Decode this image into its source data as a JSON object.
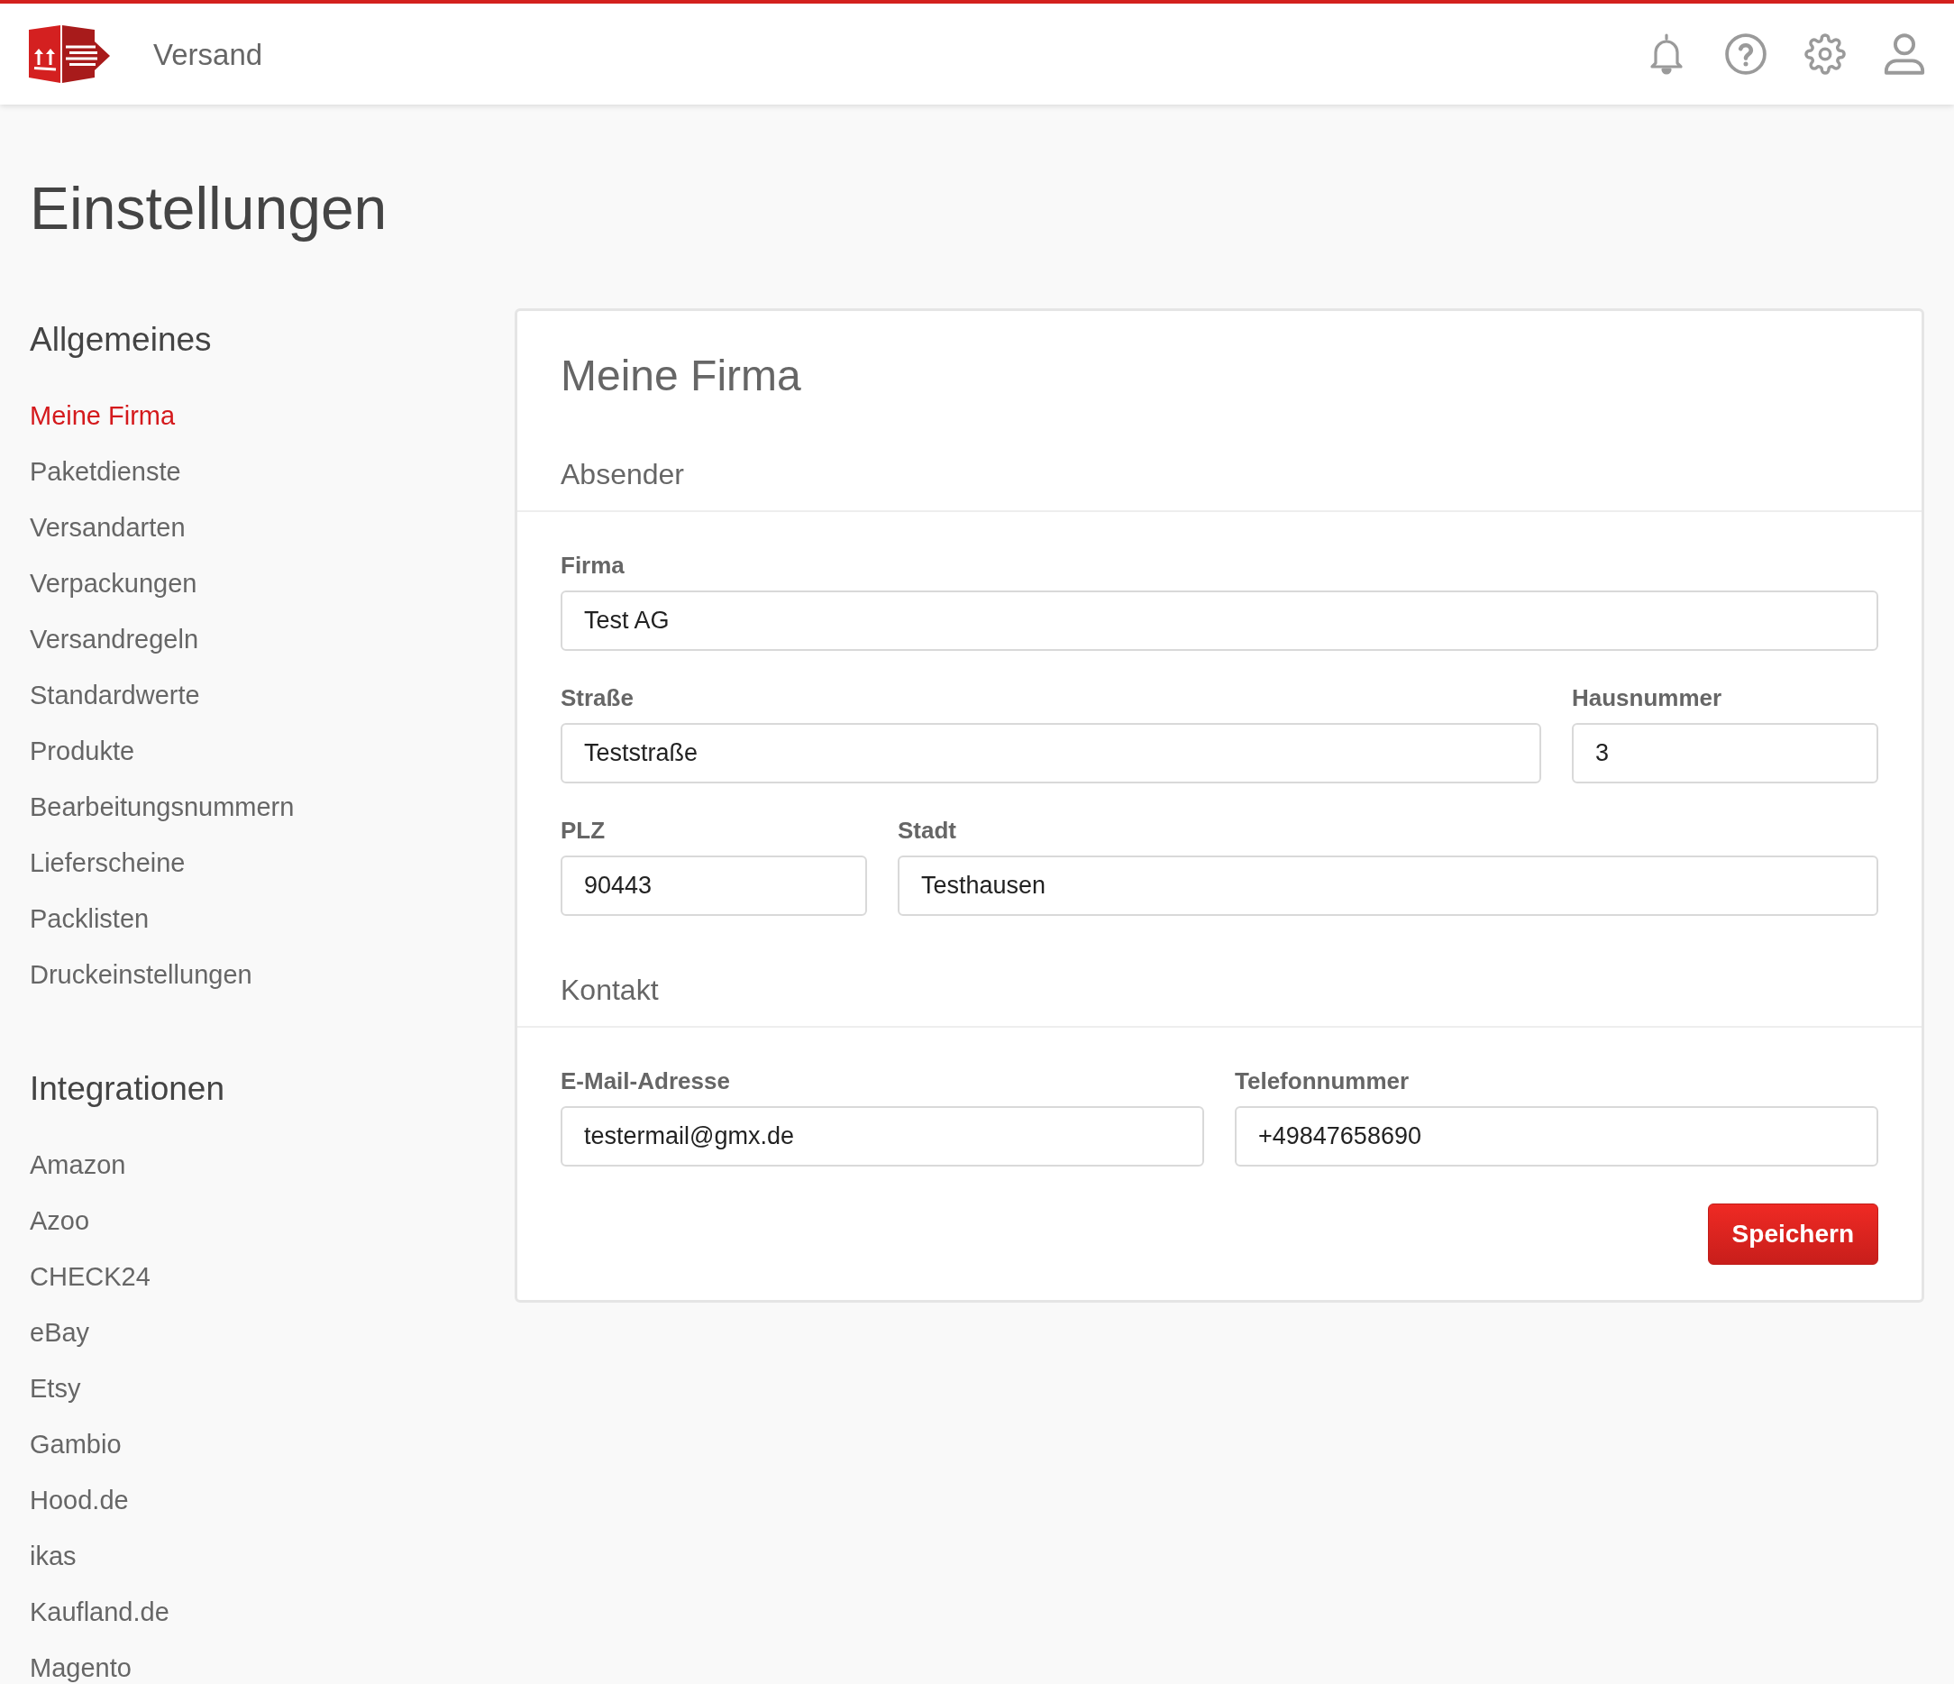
{
  "header": {
    "app_name": "Versand"
  },
  "page_title": "Einstellungen",
  "sidebar": {
    "sections": [
      {
        "title": "Allgemeines",
        "items": [
          {
            "label": "Meine Firma",
            "selected": true
          },
          {
            "label": "Paketdienste",
            "selected": false
          },
          {
            "label": "Versandarten",
            "selected": false
          },
          {
            "label": "Verpackungen",
            "selected": false
          },
          {
            "label": "Versandregeln",
            "selected": false
          },
          {
            "label": "Standardwerte",
            "selected": false
          },
          {
            "label": "Produkte",
            "selected": false
          },
          {
            "label": "Bearbeitungsnummern",
            "selected": false
          },
          {
            "label": "Lieferscheine",
            "selected": false
          },
          {
            "label": "Packlisten",
            "selected": false
          },
          {
            "label": "Druckeinstellungen",
            "selected": false
          }
        ]
      },
      {
        "title": "Integrationen",
        "items": [
          {
            "label": "Amazon",
            "selected": false
          },
          {
            "label": "Azoo",
            "selected": false
          },
          {
            "label": "CHECK24",
            "selected": false
          },
          {
            "label": "eBay",
            "selected": false
          },
          {
            "label": "Etsy",
            "selected": false
          },
          {
            "label": "Gambio",
            "selected": false
          },
          {
            "label": "Hood.de",
            "selected": false
          },
          {
            "label": "ikas",
            "selected": false
          },
          {
            "label": "Kaufland.de",
            "selected": false
          },
          {
            "label": "Magento",
            "selected": false
          }
        ]
      }
    ]
  },
  "card": {
    "title": "Meine Firma",
    "sections": [
      {
        "title": "Absender",
        "fields": [
          {
            "label": "Firma",
            "value": "Test AG"
          },
          {
            "label": "Straße",
            "value": "Teststraße"
          },
          {
            "label": "Hausnummer",
            "value": "3"
          },
          {
            "label": "PLZ",
            "value": "90443"
          },
          {
            "label": "Stadt",
            "value": "Testhausen"
          }
        ]
      },
      {
        "title": "Kontakt",
        "fields": [
          {
            "label": "E-Mail-Adresse",
            "value": "testermail@gmx.de"
          },
          {
            "label": "Telefonnummer",
            "value": "+49847658690"
          }
        ]
      }
    ],
    "save_button": "Speichern"
  }
}
